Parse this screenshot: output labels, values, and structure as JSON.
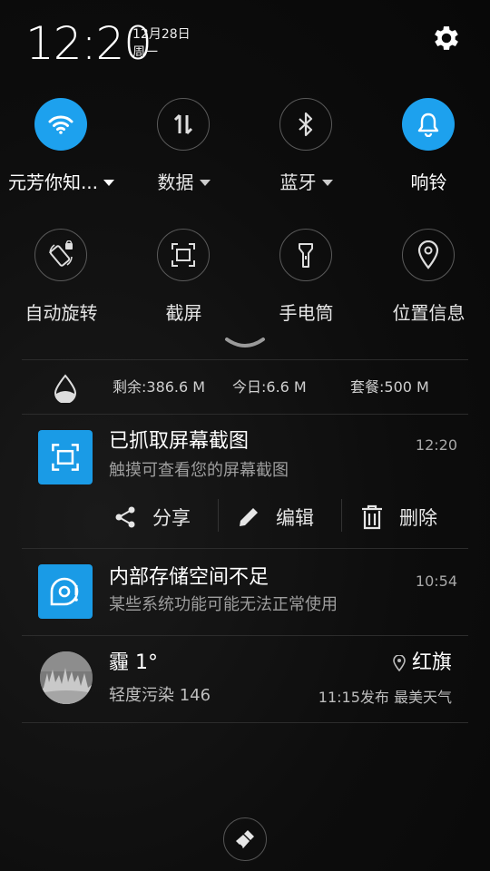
{
  "status": {
    "time": "12:20",
    "date": "12月28日",
    "weekday": "周一"
  },
  "quick_settings": {
    "row1": [
      {
        "label": "元芳你知...",
        "state": "on",
        "icon": "wifi-icon",
        "has_caret": true
      },
      {
        "label": "数据",
        "state": "off",
        "icon": "mobile-data-icon",
        "has_caret": true
      },
      {
        "label": "蓝牙",
        "state": "off",
        "icon": "bluetooth-icon",
        "has_caret": true
      },
      {
        "label": "响铃",
        "state": "on",
        "icon": "bell-icon",
        "has_caret": false
      }
    ],
    "row2": [
      {
        "label": "自动旋转",
        "state": "off",
        "icon": "auto-rotate-icon"
      },
      {
        "label": "截屏",
        "state": "off",
        "icon": "screenshot-icon"
      },
      {
        "label": "手电筒",
        "state": "off",
        "icon": "flashlight-icon"
      },
      {
        "label": "位置信息",
        "state": "off",
        "icon": "location-icon"
      }
    ]
  },
  "data_usage": {
    "remaining": "剩余:386.6 M",
    "today": "今日:6.6 M",
    "plan": "套餐:500 M"
  },
  "notifications": {
    "screenshot": {
      "title": "已抓取屏幕截图",
      "subtitle": "触摸可查看您的屏幕截图",
      "time": "12:20",
      "actions": {
        "share": "分享",
        "edit": "编辑",
        "delete": "删除"
      }
    },
    "storage": {
      "title": "内部存储空间不足",
      "subtitle": "某些系统功能可能无法正常使用",
      "time": "10:54"
    },
    "weather": {
      "title": "霾 1°",
      "subtitle": "轻度污染 146",
      "location": "红旗",
      "published": "11:15发布 最美天气"
    }
  },
  "colors": {
    "accent": "#1da1ee",
    "background": "#0d0d0d"
  }
}
